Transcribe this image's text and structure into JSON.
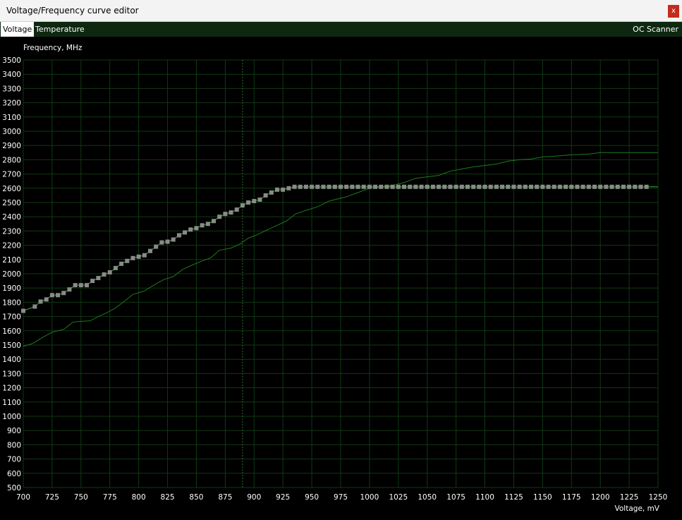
{
  "window": {
    "title": "Voltage/Frequency curve editor",
    "close_label": "x"
  },
  "tabs": [
    {
      "label": "Voltage",
      "active": true
    },
    {
      "label": "Temperature",
      "active": false
    }
  ],
  "oc_scanner_label": "OC Scanner",
  "colors": {
    "background": "#000000",
    "grid": "#0f3a12",
    "curve": "#2fb52f",
    "points": "#8a8a8a",
    "tab_bar": "#0e2810"
  },
  "chart_data": {
    "type": "line",
    "ylabel": "Frequency, MHz",
    "xlabel": "Voltage, mV",
    "xlim": [
      700,
      1250
    ],
    "ylim": [
      500,
      3500
    ],
    "x_ticks": [
      700,
      725,
      750,
      775,
      800,
      825,
      850,
      875,
      900,
      925,
      950,
      975,
      1000,
      1025,
      1050,
      1075,
      1100,
      1125,
      1150,
      1175,
      1200,
      1225,
      1250
    ],
    "y_ticks": [
      500,
      600,
      700,
      800,
      900,
      1000,
      1100,
      1200,
      1300,
      1400,
      1500,
      1600,
      1700,
      1800,
      1900,
      2000,
      2100,
      2200,
      2300,
      2400,
      2500,
      2600,
      2700,
      2800,
      2900,
      3000,
      3100,
      3200,
      3300,
      3400,
      3500
    ],
    "grid": true,
    "cursor_voltage": 890,
    "series": [
      {
        "role": "edited curve",
        "points": [
          [
            700,
            1740
          ],
          [
            710,
            1770
          ],
          [
            715,
            1805
          ],
          [
            720,
            1820
          ],
          [
            725,
            1850
          ],
          [
            730,
            1850
          ],
          [
            735,
            1865
          ],
          [
            740,
            1890
          ],
          [
            745,
            1920
          ],
          [
            750,
            1920
          ],
          [
            755,
            1920
          ],
          [
            760,
            1950
          ],
          [
            765,
            1970
          ],
          [
            770,
            1995
          ],
          [
            775,
            2010
          ],
          [
            780,
            2040
          ],
          [
            785,
            2070
          ],
          [
            790,
            2090
          ],
          [
            795,
            2110
          ],
          [
            800,
            2120
          ],
          [
            805,
            2130
          ],
          [
            810,
            2160
          ],
          [
            815,
            2190
          ],
          [
            820,
            2220
          ],
          [
            825,
            2225
          ],
          [
            830,
            2240
          ],
          [
            835,
            2270
          ],
          [
            840,
            2290
          ],
          [
            845,
            2310
          ],
          [
            850,
            2320
          ],
          [
            855,
            2340
          ],
          [
            860,
            2350
          ],
          [
            865,
            2370
          ],
          [
            870,
            2400
          ],
          [
            875,
            2420
          ],
          [
            880,
            2430
          ],
          [
            885,
            2450
          ],
          [
            890,
            2480
          ],
          [
            895,
            2500
          ],
          [
            900,
            2510
          ],
          [
            905,
            2520
          ],
          [
            910,
            2550
          ],
          [
            915,
            2570
          ],
          [
            920,
            2590
          ],
          [
            925,
            2590
          ],
          [
            930,
            2600
          ],
          [
            935,
            2610
          ],
          [
            940,
            2610
          ],
          [
            945,
            2610
          ],
          [
            950,
            2610
          ],
          [
            955,
            2610
          ],
          [
            960,
            2610
          ],
          [
            965,
            2610
          ],
          [
            970,
            2610
          ],
          [
            975,
            2610
          ],
          [
            980,
            2610
          ],
          [
            985,
            2610
          ],
          [
            990,
            2610
          ],
          [
            995,
            2610
          ],
          [
            1000,
            2610
          ],
          [
            1005,
            2610
          ],
          [
            1010,
            2610
          ],
          [
            1015,
            2610
          ],
          [
            1020,
            2610
          ],
          [
            1025,
            2610
          ],
          [
            1030,
            2610
          ],
          [
            1035,
            2610
          ],
          [
            1040,
            2610
          ],
          [
            1045,
            2610
          ],
          [
            1050,
            2610
          ],
          [
            1055,
            2610
          ],
          [
            1060,
            2610
          ],
          [
            1065,
            2610
          ],
          [
            1070,
            2610
          ],
          [
            1075,
            2610
          ],
          [
            1080,
            2610
          ],
          [
            1085,
            2610
          ],
          [
            1090,
            2610
          ],
          [
            1095,
            2610
          ],
          [
            1100,
            2610
          ],
          [
            1105,
            2610
          ],
          [
            1110,
            2610
          ],
          [
            1115,
            2610
          ],
          [
            1120,
            2610
          ],
          [
            1125,
            2610
          ],
          [
            1130,
            2610
          ],
          [
            1135,
            2610
          ],
          [
            1140,
            2610
          ],
          [
            1145,
            2610
          ],
          [
            1150,
            2610
          ],
          [
            1155,
            2610
          ],
          [
            1160,
            2610
          ],
          [
            1165,
            2610
          ],
          [
            1170,
            2610
          ],
          [
            1175,
            2610
          ],
          [
            1180,
            2610
          ],
          [
            1185,
            2610
          ],
          [
            1190,
            2610
          ],
          [
            1195,
            2610
          ],
          [
            1200,
            2610
          ],
          [
            1205,
            2610
          ],
          [
            1210,
            2610
          ],
          [
            1215,
            2610
          ],
          [
            1220,
            2610
          ],
          [
            1225,
            2610
          ],
          [
            1230,
            2610
          ],
          [
            1235,
            2610
          ],
          [
            1240,
            2610
          ]
        ]
      },
      {
        "role": "default curve",
        "points": [
          [
            700,
            1490
          ],
          [
            708,
            1510
          ],
          [
            716,
            1550
          ],
          [
            725,
            1590
          ],
          [
            735,
            1610
          ],
          [
            743,
            1660
          ],
          [
            748,
            1665
          ],
          [
            758,
            1670
          ],
          [
            765,
            1700
          ],
          [
            772,
            1725
          ],
          [
            780,
            1760
          ],
          [
            788,
            1810
          ],
          [
            795,
            1855
          ],
          [
            805,
            1880
          ],
          [
            815,
            1930
          ],
          [
            822,
            1960
          ],
          [
            830,
            1980
          ],
          [
            838,
            2030
          ],
          [
            846,
            2060
          ],
          [
            855,
            2090
          ],
          [
            862,
            2110
          ],
          [
            870,
            2165
          ],
          [
            880,
            2180
          ],
          [
            888,
            2210
          ],
          [
            895,
            2250
          ],
          [
            903,
            2275
          ],
          [
            912,
            2310
          ],
          [
            920,
            2340
          ],
          [
            928,
            2370
          ],
          [
            936,
            2420
          ],
          [
            945,
            2445
          ],
          [
            955,
            2470
          ],
          [
            965,
            2510
          ],
          [
            980,
            2540
          ],
          [
            990,
            2570
          ],
          [
            1000,
            2600
          ],
          [
            1010,
            2610
          ],
          [
            1020,
            2620
          ],
          [
            1030,
            2640
          ],
          [
            1040,
            2670
          ],
          [
            1050,
            2680
          ],
          [
            1060,
            2690
          ],
          [
            1070,
            2720
          ],
          [
            1080,
            2735
          ],
          [
            1090,
            2750
          ],
          [
            1100,
            2760
          ],
          [
            1110,
            2770
          ],
          [
            1120,
            2790
          ],
          [
            1130,
            2800
          ],
          [
            1140,
            2805
          ],
          [
            1150,
            2820
          ],
          [
            1160,
            2825
          ],
          [
            1175,
            2835
          ],
          [
            1190,
            2840
          ],
          [
            1200,
            2850
          ],
          [
            1225,
            2850
          ],
          [
            1250,
            2850
          ]
        ]
      }
    ]
  }
}
